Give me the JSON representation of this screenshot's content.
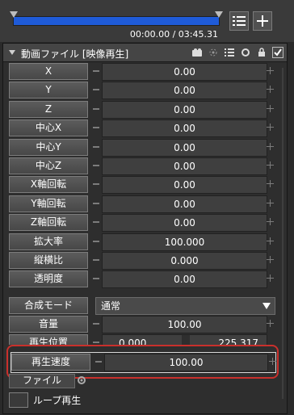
{
  "timeline": {
    "time_display": "00:00.00 / 03:45.31",
    "progress": 0.0,
    "colors": {
      "track_fill": "#1f5bd8"
    }
  },
  "toolbar": {
    "list_icon": "list-icon",
    "add_icon": "plus-icon"
  },
  "object": {
    "title": "動画ファイル [映像再生]",
    "header_icons": [
      "camera-icon",
      "sparkle-icon",
      "list-icon",
      "loop-icon",
      "lock-icon",
      "checkbox-icon"
    ]
  },
  "params": [
    {
      "label": "X",
      "value": "0.00"
    },
    {
      "label": "Y",
      "value": "0.00"
    },
    {
      "label": "Z",
      "value": "0.00"
    },
    {
      "label": "中心X",
      "value": "0.00"
    },
    {
      "label": "中心Y",
      "value": "0.00"
    },
    {
      "label": "中心Z",
      "value": "0.00"
    },
    {
      "label": "X軸回転",
      "value": "0.00"
    },
    {
      "label": "Y軸回転",
      "value": "0.00"
    },
    {
      "label": "Z軸回転",
      "value": "0.00"
    },
    {
      "label": "拡大率",
      "value": "100.000"
    },
    {
      "label": "縦横比",
      "value": "0.000"
    },
    {
      "label": "透明度",
      "value": "0.00"
    }
  ],
  "blend": {
    "label": "合成モード",
    "value": "通常"
  },
  "volume": {
    "label": "音量",
    "value": "100.00"
  },
  "playpos": {
    "label": "再生位置",
    "start": "0.000",
    "end": "225.317"
  },
  "speed": {
    "label": "再生速度",
    "value": "100.00"
  },
  "file": {
    "label": "ファイル"
  },
  "loop": {
    "label": "ループ再生"
  }
}
